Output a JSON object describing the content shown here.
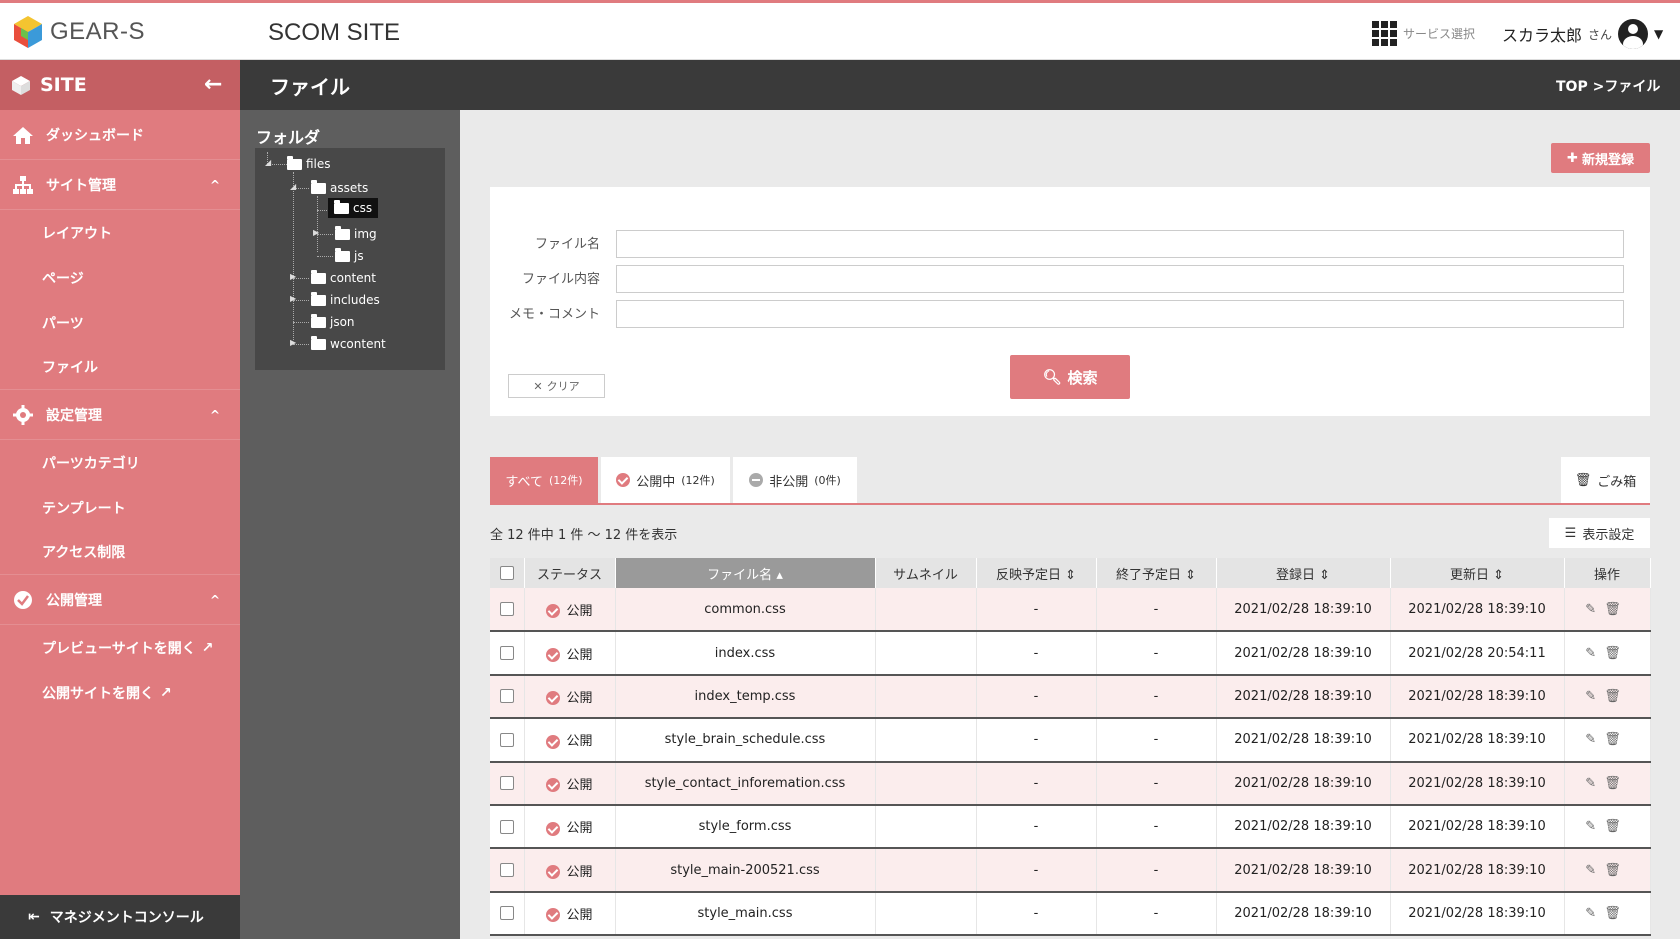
{
  "header": {
    "logo_text": "GEAR-S",
    "site_title": "SCOM SITE",
    "service_select": "サービス選択",
    "user_name": "スカラ太郎",
    "user_suffix": "さん"
  },
  "sidebar": {
    "title": "SITE",
    "dashboard": "ダッシュボード",
    "site_mgmt": "サイト管理",
    "site_items": [
      "レイアウト",
      "ページ",
      "パーツ",
      "ファイル"
    ],
    "settings_mgmt": "設定管理",
    "settings_items": [
      "パーツカテゴリ",
      "テンプレート",
      "アクセス制限"
    ],
    "publish_mgmt": "公開管理",
    "publish_items": [
      "プレビューサイトを開く",
      "公開サイトを開く"
    ],
    "footer": "マネジメントコンソール"
  },
  "titlebar": {
    "title": "ファイル",
    "breadcrumb": "TOP >ファイル"
  },
  "folder": {
    "title": "フォルダ",
    "nodes": [
      "files",
      "assets",
      "css",
      "img",
      "js",
      "content",
      "includes",
      "json",
      "wcontent"
    ]
  },
  "actions": {
    "new": "新規登録"
  },
  "search": {
    "label_name": "ファイル名",
    "label_content": "ファイル内容",
    "label_memo": "メモ・コメント",
    "value_name": "",
    "value_content": "",
    "value_memo": "",
    "search_btn": "検索",
    "clear_btn": "クリア"
  },
  "tabs": {
    "all": "すべて",
    "all_count": "(12件)",
    "public": "公開中",
    "public_count": "(12件)",
    "private": "非公開",
    "private_count": "(0件)",
    "trash": "ごみ箱"
  },
  "count_text": "全 12 件中 1 件 〜 12 件を表示",
  "display_settings": "表示設定",
  "table": {
    "columns": [
      "ステータス",
      "ファイル名",
      "サムネイル",
      "反映予定日",
      "終了予定日",
      "登録日",
      "更新日",
      "操作"
    ],
    "rows": [
      {
        "status": "公開",
        "name": "common.css",
        "thumb": "",
        "start": "-",
        "end": "-",
        "created": "2021/02/28 18:39:10",
        "updated": "2021/02/28 18:39:10"
      },
      {
        "status": "公開",
        "name": "index.css",
        "thumb": "",
        "start": "-",
        "end": "-",
        "created": "2021/02/28 18:39:10",
        "updated": "2021/02/28 20:54:11"
      },
      {
        "status": "公開",
        "name": "index_temp.css",
        "thumb": "",
        "start": "-",
        "end": "-",
        "created": "2021/02/28 18:39:10",
        "updated": "2021/02/28 18:39:10"
      },
      {
        "status": "公開",
        "name": "style_brain_schedule.css",
        "thumb": "",
        "start": "-",
        "end": "-",
        "created": "2021/02/28 18:39:10",
        "updated": "2021/02/28 18:39:10"
      },
      {
        "status": "公開",
        "name": "style_contact_inforemation.css",
        "thumb": "",
        "start": "-",
        "end": "-",
        "created": "2021/02/28 18:39:10",
        "updated": "2021/02/28 18:39:10"
      },
      {
        "status": "公開",
        "name": "style_form.css",
        "thumb": "",
        "start": "-",
        "end": "-",
        "created": "2021/02/28 18:39:10",
        "updated": "2021/02/28 18:39:10"
      },
      {
        "status": "公開",
        "name": "style_main-200521.css",
        "thumb": "",
        "start": "-",
        "end": "-",
        "created": "2021/02/28 18:39:10",
        "updated": "2021/02/28 18:39:10"
      },
      {
        "status": "公開",
        "name": "style_main.css",
        "thumb": "",
        "start": "-",
        "end": "-",
        "created": "2021/02/28 18:39:10",
        "updated": "2021/02/28 18:39:10"
      }
    ]
  },
  "colors": {
    "accent": "#e07b7f",
    "dark": "#3a3a3a",
    "panel": "#5e5e5e"
  }
}
